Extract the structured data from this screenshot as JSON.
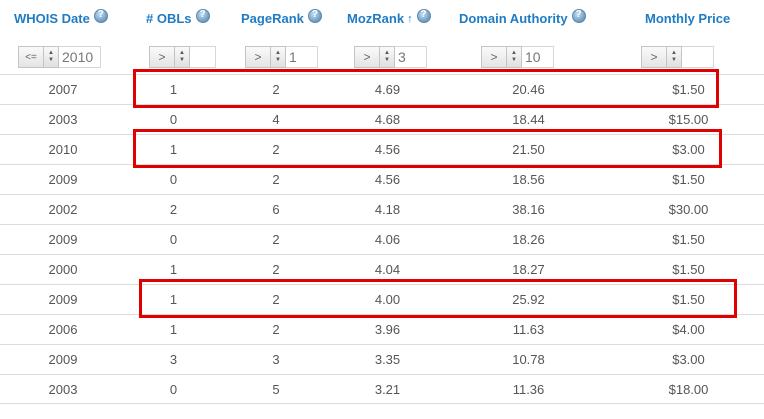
{
  "columns": [
    {
      "label": "WHOIS Date",
      "filter_op": "<=",
      "filter_value": "2010",
      "sorted": false
    },
    {
      "label": "# OBLs",
      "filter_op": ">",
      "filter_value": "",
      "sorted": false
    },
    {
      "label": "PageRank",
      "filter_op": ">",
      "filter_value": "1",
      "sorted": false
    },
    {
      "label": "MozRank",
      "sort_indicator": "↑",
      "filter_op": ">",
      "filter_value": "3",
      "sorted": true
    },
    {
      "label": "Domain Authority",
      "filter_op": ">",
      "filter_value": "10",
      "sorted": false
    },
    {
      "label": "Monthly Price",
      "filter_op": ">",
      "filter_value": "",
      "sorted": false
    }
  ],
  "rows": [
    {
      "whois": "2007",
      "obls": "1",
      "pagerank": "2",
      "mozrank": "4.69",
      "da": "20.46",
      "price": "$1.50",
      "highlighted": true
    },
    {
      "whois": "2003",
      "obls": "0",
      "pagerank": "4",
      "mozrank": "4.68",
      "da": "18.44",
      "price": "$15.00",
      "highlighted": false
    },
    {
      "whois": "2010",
      "obls": "1",
      "pagerank": "2",
      "mozrank": "4.56",
      "da": "21.50",
      "price": "$3.00",
      "highlighted": true
    },
    {
      "whois": "2009",
      "obls": "0",
      "pagerank": "2",
      "mozrank": "4.56",
      "da": "18.56",
      "price": "$1.50",
      "highlighted": false
    },
    {
      "whois": "2002",
      "obls": "2",
      "pagerank": "6",
      "mozrank": "4.18",
      "da": "38.16",
      "price": "$30.00",
      "highlighted": false
    },
    {
      "whois": "2009",
      "obls": "0",
      "pagerank": "2",
      "mozrank": "4.06",
      "da": "18.26",
      "price": "$1.50",
      "highlighted": false
    },
    {
      "whois": "2000",
      "obls": "1",
      "pagerank": "2",
      "mozrank": "4.04",
      "da": "18.27",
      "price": "$1.50",
      "highlighted": false
    },
    {
      "whois": "2009",
      "obls": "1",
      "pagerank": "2",
      "mozrank": "4.00",
      "da": "25.92",
      "price": "$1.50",
      "highlighted": true
    },
    {
      "whois": "2006",
      "obls": "1",
      "pagerank": "2",
      "mozrank": "3.96",
      "da": "11.63",
      "price": "$4.00",
      "highlighted": false
    },
    {
      "whois": "2009",
      "obls": "3",
      "pagerank": "3",
      "mozrank": "3.35",
      "da": "10.78",
      "price": "$3.00",
      "highlighted": false
    },
    {
      "whois": "2003",
      "obls": "0",
      "pagerank": "5",
      "mozrank": "3.21",
      "da": "11.36",
      "price": "$18.00",
      "highlighted": false
    }
  ],
  "colors": {
    "header_text": "#1f7cc4",
    "highlight_border": "#e00000",
    "cell_text": "#555555"
  }
}
